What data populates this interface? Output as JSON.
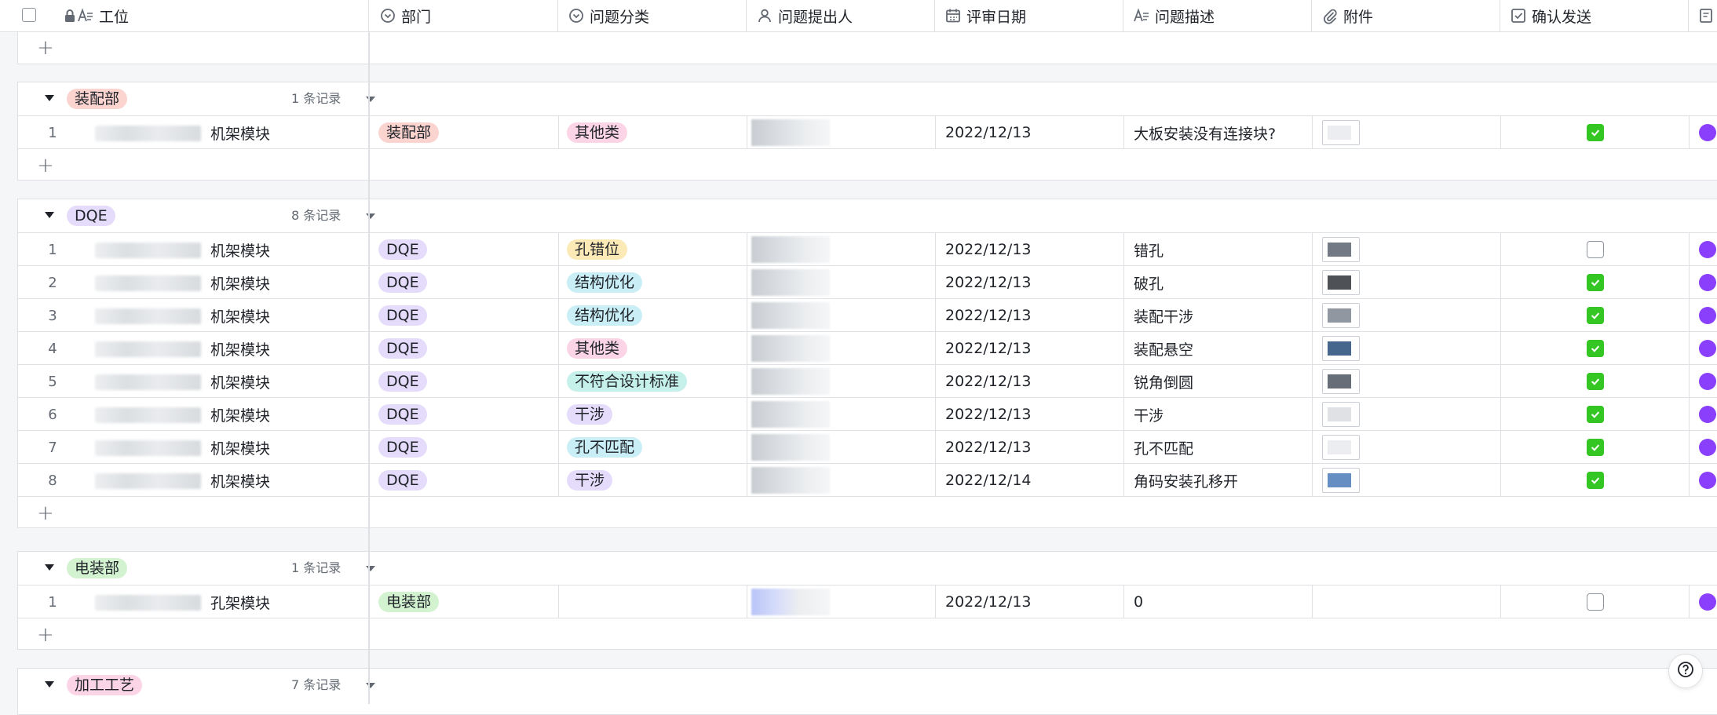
{
  "columns": [
    {
      "label": "工位",
      "icon": "text-icon"
    },
    {
      "label": "部门",
      "icon": "single-select-icon"
    },
    {
      "label": "问题分类",
      "icon": "single-select-icon"
    },
    {
      "label": "问题提出人",
      "icon": "person-icon"
    },
    {
      "label": "评审日期",
      "icon": "calendar-icon"
    },
    {
      "label": "问题描述",
      "icon": "text-icon"
    },
    {
      "label": "附件",
      "icon": "attachment-icon"
    },
    {
      "label": "确认发送",
      "icon": "checkbox-icon"
    }
  ],
  "colors": {
    "pink_bg": "#fbd4d0",
    "purple_bg": "#e5dcfb",
    "yellow_bg": "#fbe9b6",
    "cyan_bg": "#c9eef6",
    "green_bg": "#d3f2d0",
    "check_green": "#34c724",
    "avatar_purple": "#8a3ffc"
  },
  "groups": [
    {
      "name": "装配部",
      "count": "1 条记录",
      "tag_color": "#fbd4d0",
      "rows": [
        {
          "num": "1",
          "station": "机架模块",
          "dept": "装配部",
          "dept_color": "#fbd4d0",
          "category": "其他类",
          "cat_color": "#fbd4e6",
          "date": "2022/12/13",
          "desc": "大板安装没有连接块?",
          "checked": true
        }
      ]
    },
    {
      "name": "DQE",
      "count": "8 条记录",
      "tag_color": "#e5dcfb",
      "rows": [
        {
          "num": "1",
          "station": "机架模块",
          "dept": "DQE",
          "dept_color": "#e5dcfb",
          "category": "孔错位",
          "cat_color": "#fbe9b6",
          "date": "2022/12/13",
          "desc": "错孔",
          "checked": false
        },
        {
          "num": "2",
          "station": "机架模块",
          "dept": "DQE",
          "dept_color": "#e5dcfb",
          "category": "结构优化",
          "cat_color": "#c9eef6",
          "date": "2022/12/13",
          "desc": "破孔",
          "checked": true
        },
        {
          "num": "3",
          "station": "机架模块",
          "dept": "DQE",
          "dept_color": "#e5dcfb",
          "category": "结构优化",
          "cat_color": "#c9eef6",
          "date": "2022/12/13",
          "desc": "装配干涉",
          "checked": true
        },
        {
          "num": "4",
          "station": "机架模块",
          "dept": "DQE",
          "dept_color": "#e5dcfb",
          "category": "其他类",
          "cat_color": "#fbd4e6",
          "date": "2022/12/13",
          "desc": "装配悬空",
          "checked": true
        },
        {
          "num": "5",
          "station": "机架模块",
          "dept": "DQE",
          "dept_color": "#e5dcfb",
          "category": "不符合设计标准",
          "cat_color": "#c6f0ea",
          "date": "2022/12/13",
          "desc": "锐角倒圆",
          "checked": true
        },
        {
          "num": "6",
          "station": "机架模块",
          "dept": "DQE",
          "dept_color": "#e5dcfb",
          "category": "干涉",
          "cat_color": "#e5dcfb",
          "date": "2022/12/13",
          "desc": "干涉",
          "checked": true
        },
        {
          "num": "7",
          "station": "机架模块",
          "dept": "DQE",
          "dept_color": "#e5dcfb",
          "category": "孔不匹配",
          "cat_color": "#c9eef6",
          "date": "2022/12/13",
          "desc": "孔不匹配",
          "checked": true
        },
        {
          "num": "8",
          "station": "机架模块",
          "dept": "DQE",
          "dept_color": "#e5dcfb",
          "category": "干涉",
          "cat_color": "#e5dcfb",
          "date": "2022/12/14",
          "desc": "角码安装孔移开",
          "checked": true
        }
      ]
    },
    {
      "name": "电装部",
      "count": "1 条记录",
      "tag_color": "#d3f2d0",
      "rows": [
        {
          "num": "1",
          "station": "孔架模块",
          "dept": "电装部",
          "dept_color": "#d3f2d0",
          "category": "",
          "cat_color": "",
          "date": "2022/12/13",
          "desc": "0",
          "checked": false
        }
      ]
    },
    {
      "name": "加工工艺",
      "count": "7 条记录",
      "tag_color": "#fbd4e6",
      "rows": []
    }
  ]
}
